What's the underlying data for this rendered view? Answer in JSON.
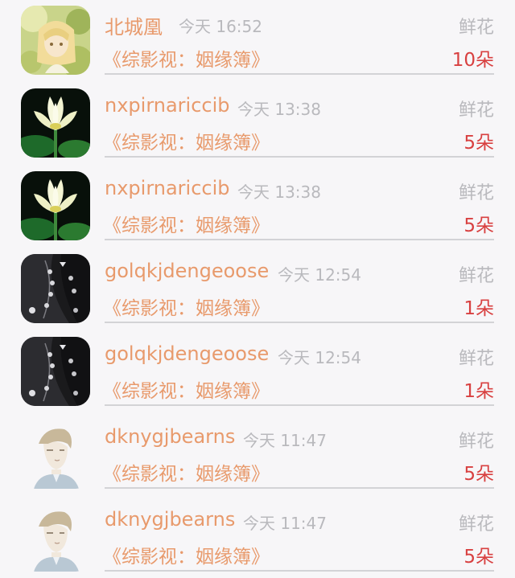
{
  "gift_list": {
    "items": [
      {
        "name": "北城凰",
        "time": "今天 16:52",
        "gift_type": "鲜花",
        "book_title": "《综影视：姻缘簿》",
        "count": "10朵",
        "avatar": "anime-girl-avatar"
      },
      {
        "name": "nxpirnariccib",
        "time": "今天 13:38",
        "gift_type": "鲜花",
        "book_title": "《综影视：姻缘簿》",
        "count": "5朵",
        "avatar": "lotus-avatar"
      },
      {
        "name": "nxpirnariccib",
        "time": "今天 13:38",
        "gift_type": "鲜花",
        "book_title": "《综影视：姻缘簿》",
        "count": "5朵",
        "avatar": "lotus-avatar"
      },
      {
        "name": "golqkjdengeoose",
        "time": "今天 12:54",
        "gift_type": "鲜花",
        "book_title": "《综影视：姻缘簿》",
        "count": "1朵",
        "avatar": "dark-jewelry-avatar"
      },
      {
        "name": "golqkjdengeoose",
        "time": "今天 12:54",
        "gift_type": "鲜花",
        "book_title": "《综影视：姻缘簿》",
        "count": "1朵",
        "avatar": "dark-jewelry-avatar"
      },
      {
        "name": "dknygjbearns",
        "time": "今天 11:47",
        "gift_type": "鲜花",
        "book_title": "《综影视：姻缘簿》",
        "count": "5朵",
        "avatar": "sketch-boy-avatar"
      },
      {
        "name": "dknygjbearns",
        "time": "今天 11:47",
        "gift_type": "鲜花",
        "book_title": "《综影视：姻缘簿》",
        "count": "5朵",
        "avatar": "sketch-boy-avatar"
      }
    ]
  }
}
